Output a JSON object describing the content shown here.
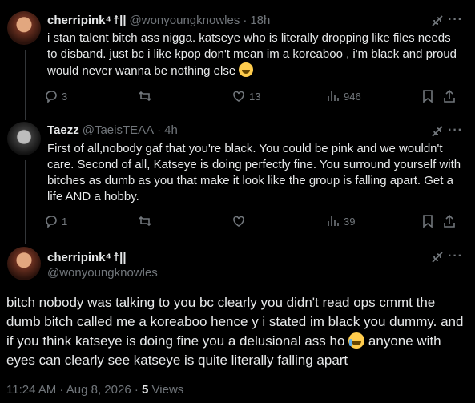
{
  "tweets": [
    {
      "name": "cherripink⁴",
      "name_badges": "☨||",
      "handle": "@wonyoungknowles",
      "time": "18h",
      "text": "i stan talent bitch ass nigga. katseye who is literally dropping like files needs to disband. just bc i like kpop don't mean im a koreaboo , i'm black and proud would never wanna be nothing else",
      "emoji": "laughing-crying-emoji",
      "replies": "3",
      "reposts": "",
      "likes": "13",
      "views": "946"
    },
    {
      "name": "Taezz",
      "handle": "@TaeisTEAA",
      "time": "4h",
      "text": "First of all,nobody gaf that you're black. You could be pink and we wouldn't care. Second of all, Katseye is doing perfectly fine. You surround yourself with bitches as dumb as you that make it look like the group is falling apart. Get a life AND a hobby.",
      "replies": "1",
      "reposts": "",
      "likes": "",
      "views": "39"
    }
  ],
  "main_tweet": {
    "name": "cherripink⁴",
    "name_badges": "☨||",
    "handle": "@wonyoungknowles",
    "text_part1": "bitch nobody was talking to you bc clearly you didn't read ops cmmt the dumb bitch called me a koreaboo hence y i stated im black you dummy. and if you think katseye is doing fine you a delusional ass ho",
    "emoji": "loudly-crying-emoji",
    "text_part2": "anyone with eyes can clearly see katseye is quite literally falling apart",
    "timestamp": "11:24 AM · Aug 8, 2026 ·",
    "views_count": "5",
    "views_label": "Views"
  },
  "separator_dot": "·",
  "more_glyph": "···"
}
